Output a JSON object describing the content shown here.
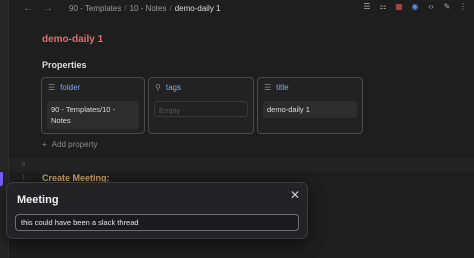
{
  "nav": {
    "back_icon": "arrow-left-icon",
    "forward_icon": "arrow-right-icon"
  },
  "breadcrumb": {
    "folder": "90 - Templates",
    "subfolder": "10 - Notes",
    "current": "demo-daily 1"
  },
  "toolbar_icons": [
    "layers-icon",
    "bookmark-icon",
    "pdf-icon",
    "git-icon",
    "code-icon",
    "edit-icon",
    "more-icon"
  ],
  "note": {
    "title": "demo-daily 1"
  },
  "properties": {
    "heading": "Properties",
    "items": [
      {
        "key": "folder",
        "value": "90 - Templates/10 - Notes"
      },
      {
        "key": "tags",
        "value": "",
        "placeholder": "Empty"
      },
      {
        "key": "title",
        "value": "demo-daily 1"
      }
    ],
    "add_label": "Add property"
  },
  "gutter": [
    "8",
    "1"
  ],
  "content": {
    "heading": "Create Meeting:"
  },
  "modal": {
    "title": "Meeting",
    "input_value": "this could have been a slack thread"
  }
}
